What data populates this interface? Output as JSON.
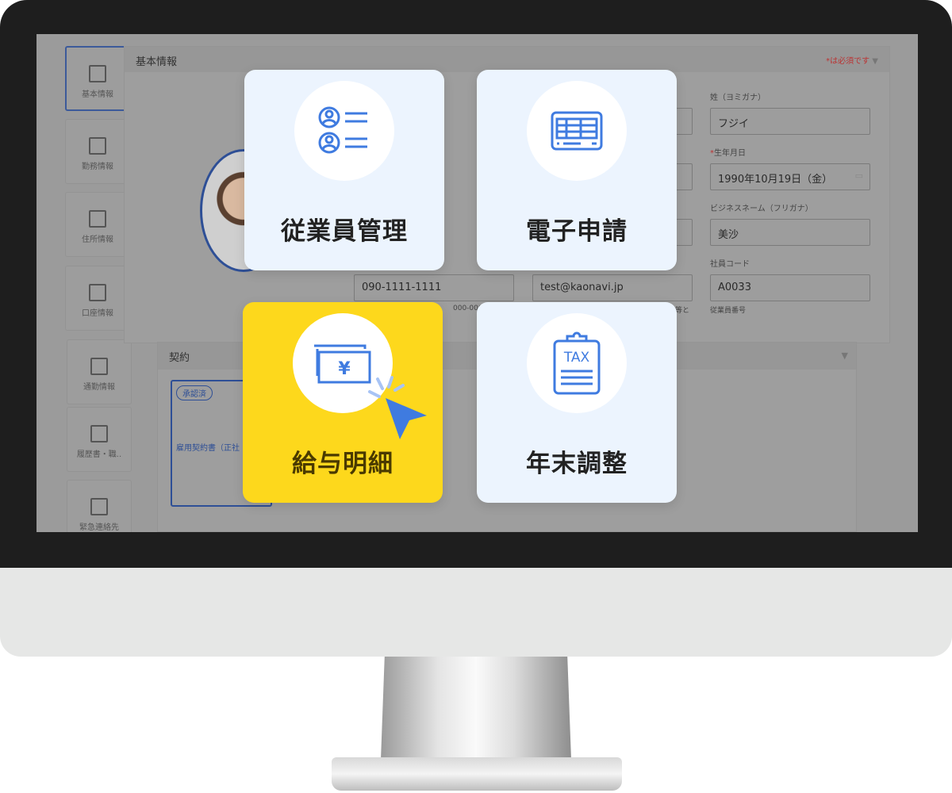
{
  "sidebar": {
    "items": [
      {
        "label": "基本情報",
        "active": true
      },
      {
        "label": "勤務情報"
      },
      {
        "label": "住所情報"
      },
      {
        "label": "口座情報"
      },
      {
        "label": "通勤情報"
      },
      {
        "label": "履歴書・職.."
      },
      {
        "label": "緊急連絡先"
      }
    ]
  },
  "basic": {
    "title": "基本情報",
    "required_note": "*は必須です",
    "fields": {
      "kana_last_label": "姓（ヨミガナ）",
      "kana_last": "フジイ",
      "birth_label": "生年月日",
      "birth": "1990年10月19日（金）",
      "biz_kana_label": "ビジネスネーム（フリガナ）",
      "biz_kana": "美沙",
      "code_label": "社員コード",
      "code": "A0033",
      "code_hint": "従業員番号",
      "phone": "090-1111-1111",
      "phone_hint": "000-0000",
      "email": "test@kaonavi.jp",
      "email_hint": "等と"
    }
  },
  "contract": {
    "title": "契約",
    "badge": "承認済",
    "doc": "雇用契約書（正社"
  },
  "cards": [
    {
      "label": "従業員管理",
      "icon": "employee-list-icon"
    },
    {
      "label": "電子申請",
      "icon": "form-table-icon"
    },
    {
      "label": "給与明細",
      "icon": "yen-bills-icon",
      "highlight": "#fdd81c"
    },
    {
      "label": "年末調整",
      "icon": "tax-clipboard-icon",
      "icon_text": "TAX"
    }
  ],
  "colors": {
    "accent": "#3f7be0",
    "highlight": "#fdd81c"
  }
}
